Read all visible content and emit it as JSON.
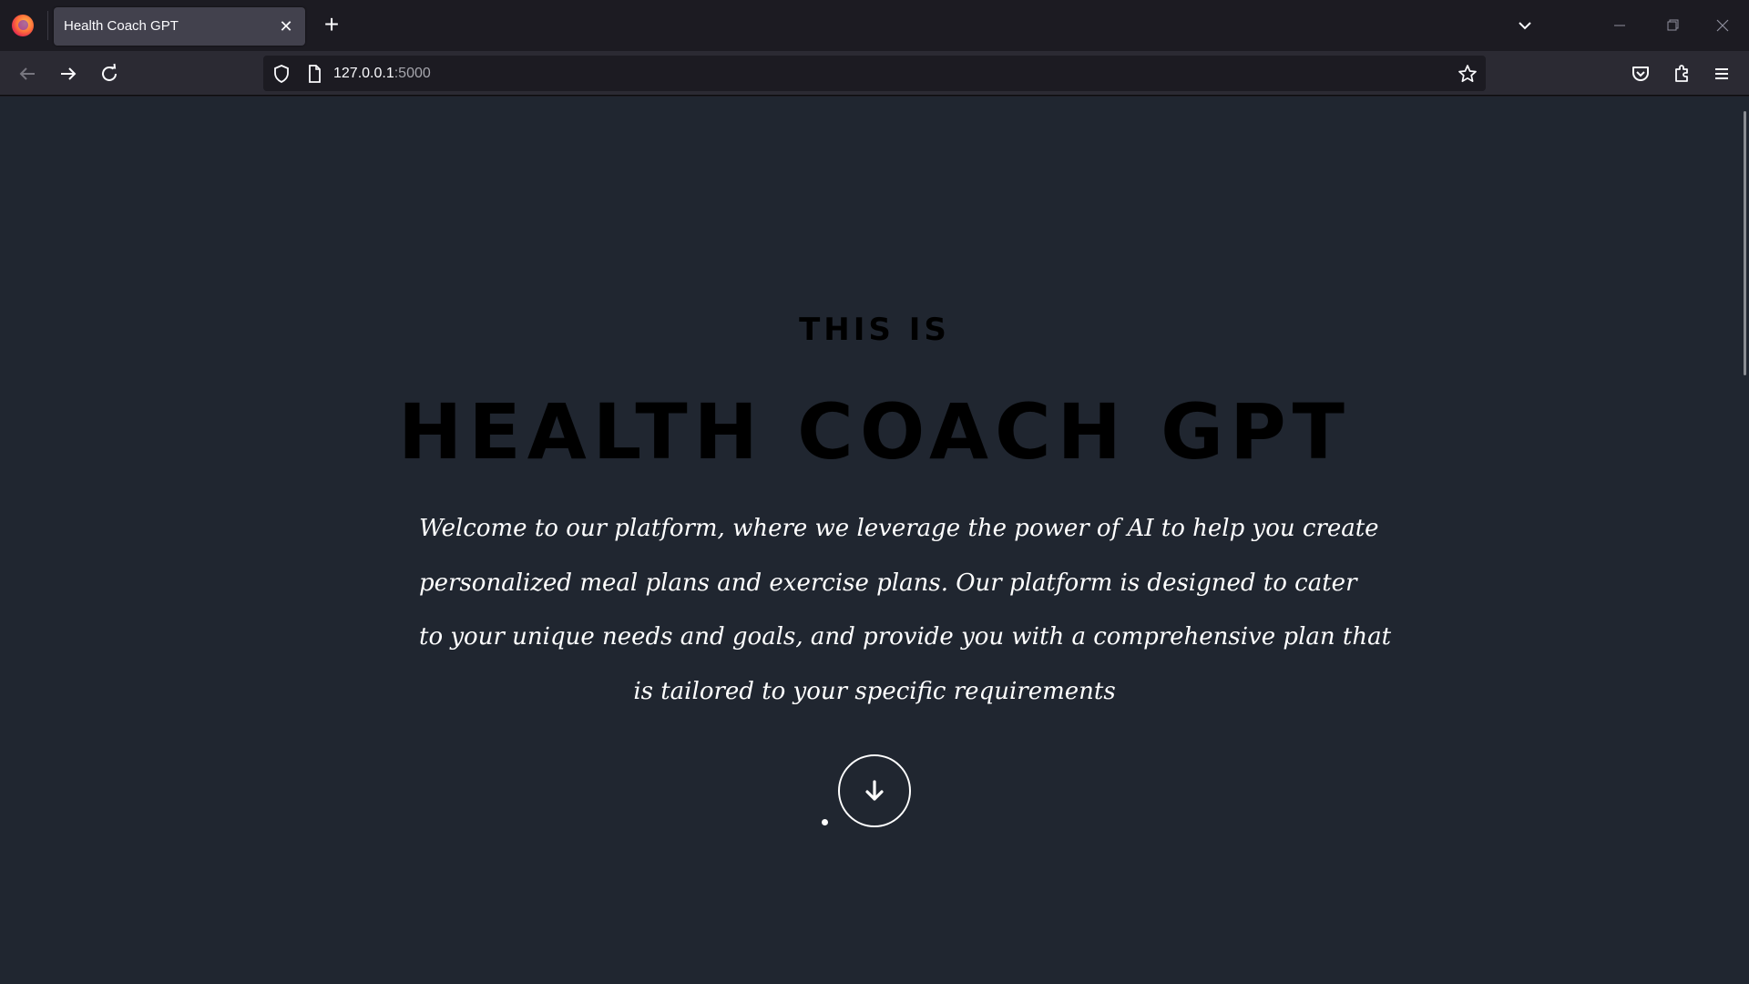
{
  "browser": {
    "tab_title": "Health Coach GPT",
    "url_host": "127.0.0.1",
    "url_port": ":5000",
    "icons": {
      "logo": "firefox-logo-icon",
      "tab_close": "close-icon",
      "new_tab": "plus-icon",
      "tab_list": "chevron-down-icon",
      "back": "arrow-left-icon",
      "forward": "arrow-right-icon",
      "reload": "reload-icon",
      "shield": "shield-icon",
      "page": "page-icon",
      "bookmark": "star-icon",
      "pocket": "pocket-icon",
      "extensions": "puzzle-icon",
      "menu": "hamburger-icon"
    }
  },
  "hero": {
    "pre_title": "THIS IS",
    "title": "HEALTH COACH GPT",
    "intro_lines": [
      "Welcome to our platform, where we leverage the power of AI to help you create",
      "personalized meal plans and exercise plans. Our platform is designed to cater",
      "to your unique needs and goals, and provide you with a comprehensive plan that",
      "is tailored to your specific requirements"
    ],
    "scroll_icon": "arrow-down-icon"
  },
  "colors": {
    "page_background": "#202630",
    "text": "#ffffff",
    "tab_strip": "#1c1b22",
    "nav_bar": "#2b2a33",
    "active_tab": "#42414d"
  }
}
